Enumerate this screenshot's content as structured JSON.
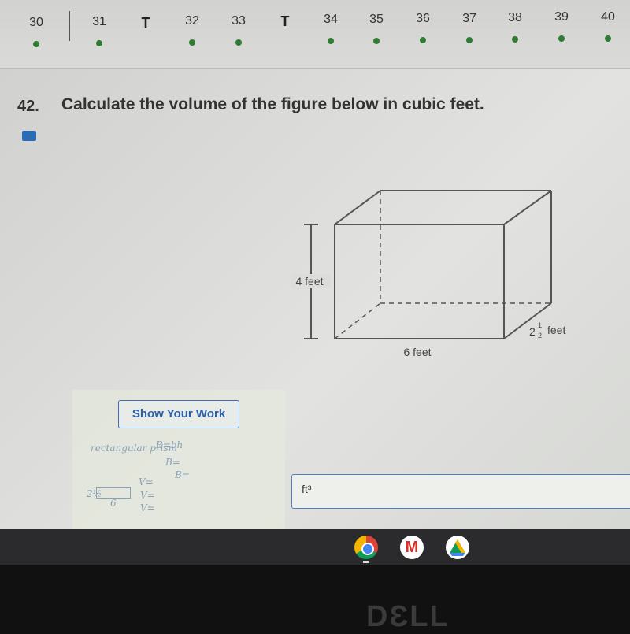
{
  "nav": {
    "items": [
      {
        "label": "30",
        "dot": true,
        "t": false
      },
      {
        "label": "31",
        "dot": true,
        "t": false
      },
      {
        "label": "T",
        "dot": false,
        "t": true
      },
      {
        "label": "32",
        "dot": true,
        "t": false
      },
      {
        "label": "33",
        "dot": true,
        "t": false
      },
      {
        "label": "T",
        "dot": false,
        "t": true
      },
      {
        "label": "34",
        "dot": true,
        "t": false
      },
      {
        "label": "35",
        "dot": true,
        "t": false
      },
      {
        "label": "36",
        "dot": true,
        "t": false
      },
      {
        "label": "37",
        "dot": true,
        "t": false
      },
      {
        "label": "38",
        "dot": true,
        "t": false
      },
      {
        "label": "39",
        "dot": true,
        "t": false
      },
      {
        "label": "40",
        "dot": true,
        "t": false
      }
    ],
    "dot_color": "#2e7d32"
  },
  "question": {
    "number": "42.",
    "text": "Calculate the volume of the figure below in cubic feet."
  },
  "figure": {
    "height_label": "4 feet",
    "length_label": "6 feet",
    "width_whole": "2",
    "width_num": "1",
    "width_den": "2",
    "width_unit": "feet"
  },
  "work": {
    "button": "Show Your Work",
    "handwriting": [
      "rectangular prism",
      "B=bh",
      "B=",
      "B=",
      "V=",
      "V=",
      "V=",
      "2½",
      "6"
    ]
  },
  "answer": {
    "unit": "ft³"
  },
  "taskbar": {
    "apps": [
      "chrome-icon",
      "gmail-icon",
      "drive-icon"
    ]
  },
  "bezel": {
    "logo": "DELL"
  }
}
